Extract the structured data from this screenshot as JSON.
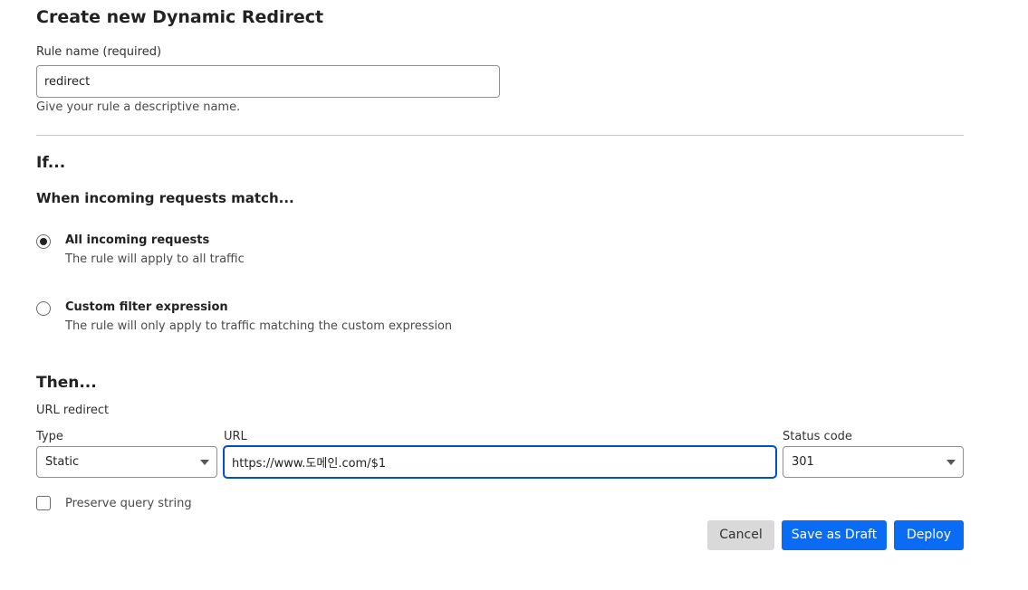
{
  "title": "Create new Dynamic Redirect",
  "rule_name": {
    "label": "Rule name (required)",
    "value": "redirect",
    "help": "Give your rule a descriptive name."
  },
  "if_section": {
    "heading": "If...",
    "subheading": "When incoming requests match...",
    "options": [
      {
        "title": "All incoming requests",
        "description": "The rule will apply to all traffic",
        "selected": true
      },
      {
        "title": "Custom filter expression",
        "description": "The rule will only apply to traffic matching the custom expression",
        "selected": false
      }
    ]
  },
  "then_section": {
    "heading": "Then...",
    "action_label": "URL redirect",
    "type": {
      "label": "Type",
      "value": "Static"
    },
    "url": {
      "label": "URL",
      "value": "https://www.도메인.com/$1"
    },
    "status_code": {
      "label": "Status code",
      "value": "301"
    },
    "preserve_query": {
      "label": "Preserve query string",
      "checked": false
    }
  },
  "buttons": {
    "cancel": "Cancel",
    "save_draft": "Save as Draft",
    "deploy": "Deploy"
  },
  "colors": {
    "primary": "#0a6cf5",
    "focus_border": "#0051c3",
    "secondary_button": "#d9d9d9"
  },
  "icons": {
    "select_caret": "chevron-down-icon"
  }
}
